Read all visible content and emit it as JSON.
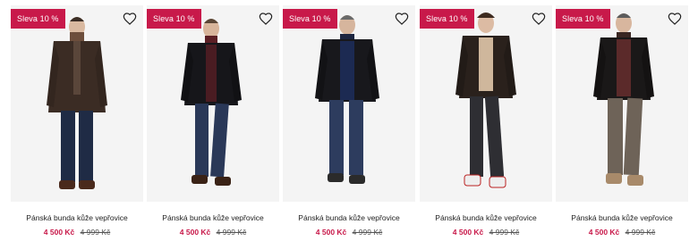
{
  "products": [
    {
      "badge": "Sleva 10 %",
      "title": "Pánská bunda kůže vepřovice",
      "price": "4 500 Kč",
      "old_price": "4 999 Kč",
      "wishlist_icon": "heart-outline-icon"
    },
    {
      "badge": "Sleva 10 %",
      "title": "Pánská bunda kůže vepřovice",
      "price": "4 500 Kč",
      "old_price": "4 999 Kč",
      "wishlist_icon": "heart-outline-icon"
    },
    {
      "badge": "Sleva 10 %",
      "title": "Pánská bunda kůže vepřovice",
      "price": "4 500 Kč",
      "old_price": "4 999 Kč",
      "wishlist_icon": "heart-outline-icon"
    },
    {
      "badge": "Sleva 10 %",
      "title": "Pánská bunda kůže vepřovice",
      "price": "4 500 Kč",
      "old_price": "4 999 Kč",
      "wishlist_icon": "heart-outline-icon"
    },
    {
      "badge": "Sleva 10 %",
      "title": "Pánská bunda kůže vepřovice",
      "price": "4 500 Kč",
      "old_price": "4 999 Kč",
      "wishlist_icon": "heart-outline-icon"
    }
  ],
  "colors": {
    "badge_bg": "#c8194a",
    "price_now": "#c8194a",
    "photo_bg": "#f4f4f4"
  }
}
